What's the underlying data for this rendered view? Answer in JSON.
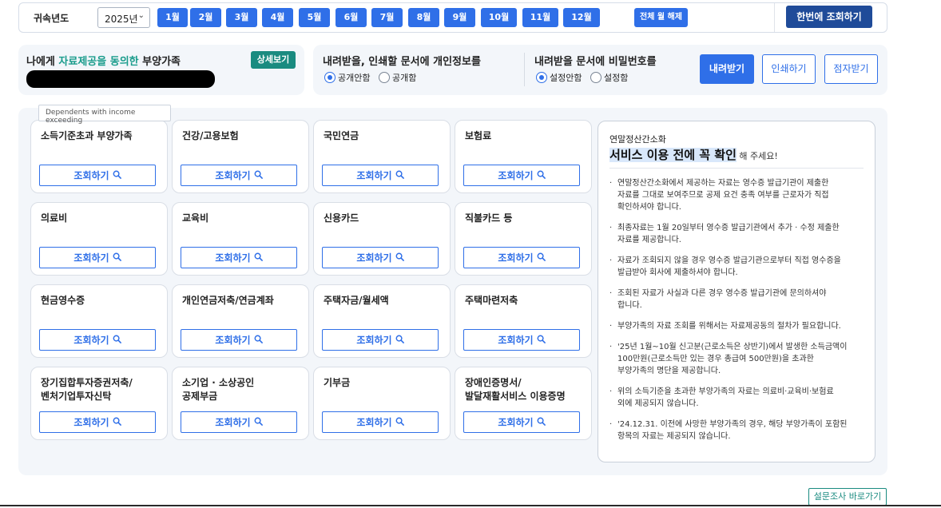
{
  "topbar": {
    "label": "귀속년도",
    "year": "2025년",
    "months": [
      "1월",
      "2월",
      "3월",
      "4월",
      "5월",
      "6월",
      "7월",
      "8월",
      "9월",
      "10월",
      "11월",
      "12월"
    ],
    "all_clear": "전체 월 해제",
    "query_all": "한번에 조회하기"
  },
  "consent": {
    "prefix": "나에게 ",
    "highlight": "자료제공을 동의한",
    "suffix": " 부양가족",
    "detail_btn": "상세보기"
  },
  "download": {
    "privacy_title": "내려받을, 인쇄할 문서에 개인정보를",
    "privacy_opt1": "공개안함",
    "privacy_opt2": "공개함",
    "pw_title": "내려받을 문서에 비밀번호를",
    "pw_opt1": "설정안함",
    "pw_opt2": "설정함",
    "download_btn": "내려받기",
    "print_btn": "인쇄하기",
    "braille_btn": "점자받기"
  },
  "tooltip": "Dependents with income exceeding",
  "cards": [
    {
      "title": "소득기준초과 부양가족"
    },
    {
      "title": "건강/고용보험"
    },
    {
      "title": "국민연금"
    },
    {
      "title": "보험료"
    },
    {
      "title": "의료비"
    },
    {
      "title": "교육비"
    },
    {
      "title": "신용카드"
    },
    {
      "title": "직불카드 등"
    },
    {
      "title": "현금영수증"
    },
    {
      "title": "개인연금저축/연금계좌"
    },
    {
      "title": "주택자금/월세액"
    },
    {
      "title": "주택마련저축"
    },
    {
      "title": "장기집합투자증권저축/\n벤처기업투자신탁"
    },
    {
      "title": "소기업 · 소상공인\n공제부금"
    },
    {
      "title": "기부금"
    },
    {
      "title": "장애인증명서/\n발달재활서비스 이용증명"
    }
  ],
  "card_button": "조회하기",
  "info": {
    "small": "연말정산간소화",
    "big": "서비스 이용 전에 꼭 확인",
    "tail": " 해 주세요!",
    "items": [
      "연말정산간소화에서 제공하는 자료는 영수증 발급기관이 제출한\n자료를 그대로 보여주므로 공제 요건 충족 여부를 근로자가 직접\n확인하셔야 합니다.",
      "최종자료는 1월 20일부터 영수증 발급기관에서 추가 · 수정 제출한\n자료를 제공합니다.",
      "자료가 조회되지 않을 경우 영수증 발급기관으로부터 직접 영수증을\n발급받아 회사에 제출하셔야 합니다.",
      "조회된 자료가 사실과 다른 경우 영수증 발급기관에 문의하셔야\n합니다.",
      "부양가족의 자료 조회를 위해서는 자료제공동의 절차가 필요합니다.",
      "'25년 1월~10월 신고분(근로소득은 상반기)에서 발생한 소득금액이\n100만원(근로소득만 있는 경우 총급여 500만원)을 초과한\n부양가족의 명단을 제공합니다.",
      "위의 소득기준을 초과한 부양가족의 자료는 의료비·교육비·보험료\n외에 제공되지 않습니다.",
      "'24.12.31. 이전에 사망한 부양가족의 경우, 해당 부양가족이 포함된\n항목의 자료는 제공되지 않습니다."
    ]
  },
  "survey": "설문조사 바로가기"
}
